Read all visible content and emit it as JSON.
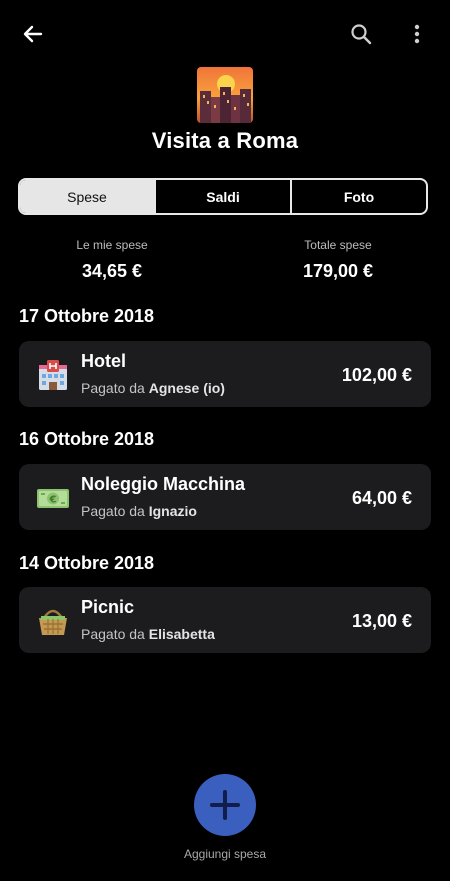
{
  "header": {
    "title": "Visita a Roma",
    "icons": [
      "back-arrow-icon",
      "search-icon",
      "more-vertical-icon",
      "city-sunset-icon"
    ]
  },
  "tabs": [
    {
      "label": "Spese",
      "active": true
    },
    {
      "label": "Saldi",
      "active": false
    },
    {
      "label": "Foto",
      "active": false
    }
  ],
  "summary": {
    "my_label": "Le mie spese",
    "my_value": "34,65 €",
    "total_label": "Totale spese",
    "total_value": "179,00 €"
  },
  "groups": [
    {
      "date": "17 Ottobre 2018",
      "expenses": [
        {
          "title": "Hotel",
          "paid_prefix": "Pagato da",
          "payer": "Agnese (io)",
          "amount": "102,00 €",
          "icon": "hotel-icon"
        }
      ]
    },
    {
      "date": "16 Ottobre 2018",
      "expenses": [
        {
          "title": "Noleggio Macchina",
          "paid_prefix": "Pagato da",
          "payer": "Ignazio",
          "amount": "64,00 €",
          "icon": "euro-banknote-icon"
        }
      ]
    },
    {
      "date": "14 Ottobre 2018",
      "expenses": [
        {
          "title": "Picnic",
          "paid_prefix": "Pagato da",
          "payer": "Elisabetta",
          "amount": "13,00 €",
          "icon": "picnic-basket-icon"
        }
      ]
    }
  ],
  "fab": {
    "label": "Aggiungi spesa",
    "icon": "plus-icon"
  },
  "colors": {
    "background": "#000000",
    "card": "#1c1c1e",
    "accent": "#3a5fbf",
    "segment_active": "#e6e6e6"
  }
}
